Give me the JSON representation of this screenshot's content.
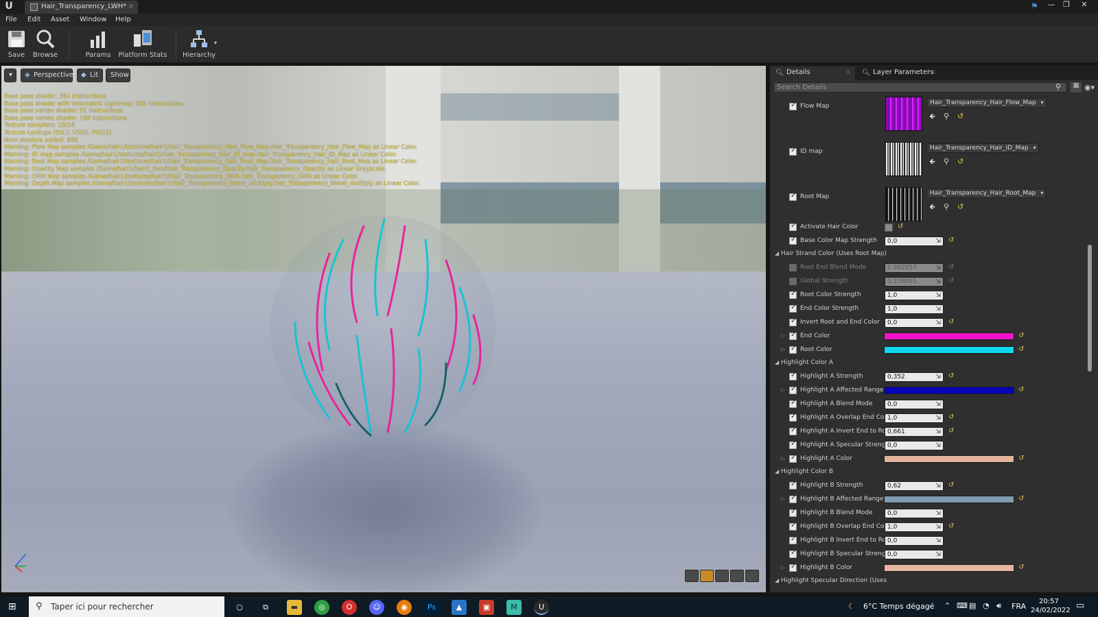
{
  "window": {
    "tab_title": "Hair_Transparency_LWH*",
    "controls": {
      "minimize": "—",
      "restore": "❐",
      "close": "✕"
    }
  },
  "menu": [
    "File",
    "Edit",
    "Asset",
    "Window",
    "Help"
  ],
  "toolbar": [
    {
      "label": "Save",
      "icon": "save-icon"
    },
    {
      "label": "Browse",
      "icon": "browse-icon"
    },
    {
      "label": "Params",
      "icon": "params-icon"
    },
    {
      "label": "Platform Stats",
      "icon": "platform-stats-icon"
    },
    {
      "label": "Hierarchy",
      "icon": "hierarchy-icon"
    }
  ],
  "viewport": {
    "buttons": {
      "menu": "▾",
      "perspective": "Perspective",
      "lit": "Lit",
      "show": "Show"
    },
    "stats": [
      "Base pass shader: 391 instructions",
      "Base pass shader with Volumetric Lightmap: 581 instructions",
      "Base pass vertex shader: 51 instructions",
      "Base pass vertex shader: 160 instructions",
      "Texture samplers: 10/16",
      "Texture Lookups (Est.): VS(0), PS(12)",
      "Num shaders added: 868",
      "Warning: Flow Map samples /Game/hair1/textures/hair1/Hair_Transparency_Hair_Flow_Map.Hair_Transparency_Hair_Flow_Map as Linear Color.",
      "Warning: ID map samples /Game/hair1/textures/hair1/Hair_Transparency_Hair_ID_Map.Hair_Transparency_Hair_ID_Map as Linear Color.",
      "Warning: Root Map samples /Game/hair1/textures/hair1/Hair_Transparency_Hair_Root_Map.Hair_Transparency_Hair_Root_Map as Linear Color.",
      "Warning: Opacity Map samples /Game/hair1/hair1_fbm/Hair_Transparency_Opacity.Hair_Transparency_Opacity as Linear Grayscale.",
      "Warning: ORM Map samples /Game/hair1/textures/hair1/Hair_Transparency_ORM.Hair_Transparency_ORM as Linear Color.",
      "Warning: Depth Map samples /Game/hair1/textures/hair1/Hair_Transparency_blend_multiply.Hair_Transparency_blend_multiply as Linear Color."
    ],
    "colors": {
      "stats_text": "#e8d247",
      "hair_pink": "#e8239c",
      "hair_cyan": "#17c3d6"
    }
  },
  "details": {
    "tabs": [
      "Details",
      "Layer Parameters"
    ],
    "search_placeholder": "Search Details",
    "textures": [
      {
        "label": "Flow Map",
        "asset": "Hair_Transparency_Hair_Flow_Map"
      },
      {
        "label": "ID map",
        "asset": "Hair_Transparency_Hair_ID_Map"
      },
      {
        "label": "Root Map",
        "asset": "Hair_Transparency_Hair_Root_Map"
      }
    ],
    "activate_hair_color": "Activate Hair Color",
    "base_color_strength": {
      "label": "Base Color Map Strength",
      "value": "0,0"
    },
    "cat_strand": "Hair Strand Color (Uses Root Map)",
    "strand_params": [
      {
        "label": "Root End Blend Mode",
        "value": "0,982857"
      },
      {
        "label": "Global Strength",
        "value": "0,238095"
      },
      {
        "label": "Root Color Strength",
        "value": "1,0"
      },
      {
        "label": "End Color Strength",
        "value": "1,0"
      },
      {
        "label": "Invert Root and End Color",
        "value": "0,0"
      }
    ],
    "end_color": {
      "label": "End Color",
      "color": "#f312c5"
    },
    "root_color": {
      "label": "Root Color",
      "color": "#0fd9ee"
    },
    "cat_highlight_a": "Highlight Color A",
    "highlight_a": [
      {
        "label": "Highlight A Strength",
        "value": "0,352"
      },
      {
        "label": "Highlight A Affected Range",
        "color": "#0404b8"
      },
      {
        "label": "Highlight A Blend Mode",
        "value": "0,0"
      },
      {
        "label": "Highlight A Overlap End Color",
        "value": "1,0"
      },
      {
        "label": "Highlight A Invert End to Root",
        "value": "0,661"
      },
      {
        "label": "Highlight A Specular Strength",
        "value": "0,0"
      },
      {
        "label": "Highlight A Color",
        "color": "#e1b49a"
      }
    ],
    "cat_highlight_b": "Highlight Color B",
    "highlight_b": [
      {
        "label": "Highlight B Strength",
        "value": "0,62"
      },
      {
        "label": "Highlight B Affected Range",
        "color": "#7f9cb0"
      },
      {
        "label": "Highlight B Blend Mode",
        "value": "0,0"
      },
      {
        "label": "Highlight B Overlap End Color",
        "value": "1,0"
      },
      {
        "label": "Highlight B Invert End to Root",
        "value": "0,0"
      },
      {
        "label": "Highlight B Specular Strength",
        "value": "0,0"
      },
      {
        "label": "Highlight B Color",
        "color": "#e7b5a2"
      }
    ],
    "cat_specular": "Highlight Specular Direction (Uses"
  },
  "taskbar": {
    "search_placeholder": "Taper ici pour rechercher",
    "weather": "6°C  Temps dégagé",
    "lang": "FRA",
    "time": "20:57",
    "date": "24/02/2022"
  }
}
